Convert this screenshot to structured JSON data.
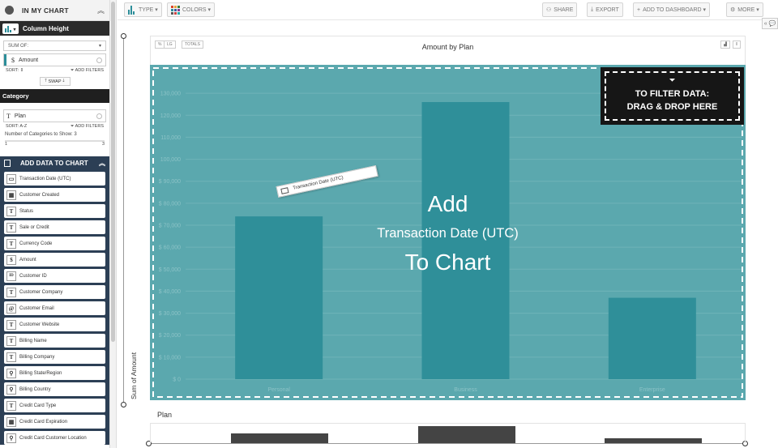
{
  "sidebar": {
    "header_title": "IN MY CHART",
    "metric_section_title": "Column Height",
    "aggregation": "SUM OF:",
    "metric_field": "Amount",
    "metric_field_glyph": "$",
    "sort_label": "SORT:",
    "add_filters": "ADD FILTERS",
    "swap_label": "SWAP",
    "category_section_title": "Category",
    "category_field": "Plan",
    "category_field_glyph": "T",
    "category_sort_label": "SORT: A-Z",
    "categories_count_label": "Number of Categories to Show: 3",
    "slider_min": "1",
    "slider_max": "3",
    "add_data_title": "ADD DATA TO CHART",
    "fields": [
      {
        "label": "Transaction Date (UTC)",
        "icon": "card-icon",
        "glyph": "▭"
      },
      {
        "label": "Customer Created",
        "icon": "calendar-icon",
        "glyph": "▦"
      },
      {
        "label": "Status",
        "icon": "text-icon",
        "glyph": "T"
      },
      {
        "label": "Sale or Credit",
        "icon": "text-icon",
        "glyph": "T"
      },
      {
        "label": "Currency Code",
        "icon": "text-icon",
        "glyph": "T"
      },
      {
        "label": "Amount",
        "icon": "dollar-icon",
        "glyph": "$"
      },
      {
        "label": "Customer ID",
        "icon": "id-icon",
        "glyph": "ID"
      },
      {
        "label": "Customer Company",
        "icon": "text-icon",
        "glyph": "T"
      },
      {
        "label": "Customer Email",
        "icon": "at-icon",
        "glyph": "@"
      },
      {
        "label": "Customer Website",
        "icon": "text-icon",
        "glyph": "T"
      },
      {
        "label": "Billing Name",
        "icon": "text-icon",
        "glyph": "T"
      },
      {
        "label": "Billing Company",
        "icon": "text-icon",
        "glyph": "T"
      },
      {
        "label": "Billing State/Region",
        "icon": "pin-icon",
        "glyph": "⚲"
      },
      {
        "label": "Billing Country",
        "icon": "pin-icon",
        "glyph": "⚲"
      },
      {
        "label": "Credit Card Type",
        "icon": "text-icon",
        "glyph": "T"
      },
      {
        "label": "Credit Card Expiration",
        "icon": "calendar-icon",
        "glyph": "▦"
      },
      {
        "label": "Credit Card Customer Location",
        "icon": "pin-icon",
        "glyph": "⚲"
      }
    ]
  },
  "toolbar": {
    "type_label": "TYPE",
    "colors_label": "COLORS",
    "share_label": "SHARE",
    "export_label": "EXPORT",
    "add_to_dashboard_label": "ADD TO DASHBOARD",
    "more_label": "MORE",
    "color_swatches": [
      "#d9452b",
      "#e8a33a",
      "#3b7d3b",
      "#2c8e9a",
      "#3a5fa0",
      "#8e3a8e",
      "#555555",
      "#c44",
      "#2aa"
    ]
  },
  "chart": {
    "title": "Amount by Plan",
    "pct_toggle": "%",
    "lg_toggle": "LG",
    "totals_toggle": "TOTALS",
    "ylabel": "Sum of Amount",
    "xaxis_title": "Plan",
    "overlay_line1": "Add",
    "overlay_line2": "Transaction Date (UTC)",
    "overlay_line3": "To Chart",
    "filter_line1": "TO FILTER DATA:",
    "filter_line2": "DRAG & DROP HERE",
    "drag_pill_label": "Transaction Date (UTC)",
    "colors": {
      "overlay": "#5ba8ae",
      "bar": "#2f8f99",
      "filter_bg": "#161616"
    }
  },
  "chart_data": {
    "type": "bar",
    "title": "Amount by Plan",
    "xlabel": "",
    "ylabel": "Sum of Amount",
    "categories": [
      "Personal",
      "Business",
      "Enterprise"
    ],
    "values": [
      74000,
      126000,
      37000
    ],
    "ylim": [
      0,
      140000
    ],
    "yticks": [
      0,
      10000,
      20000,
      30000,
      40000,
      50000,
      60000,
      70000,
      80000,
      90000,
      100000,
      110000,
      120000,
      130000
    ],
    "ytick_labels": [
      "$ 0",
      "$ 10,000",
      "$ 20,000",
      "$ 30,000",
      "$ 40,000",
      "$ 50,000",
      "$ 60,000",
      "$ 70,000",
      "$ 80,000",
      "$ 90,000",
      "100,000",
      "110,000",
      "120,000",
      "130,000"
    ],
    "grid": true
  }
}
